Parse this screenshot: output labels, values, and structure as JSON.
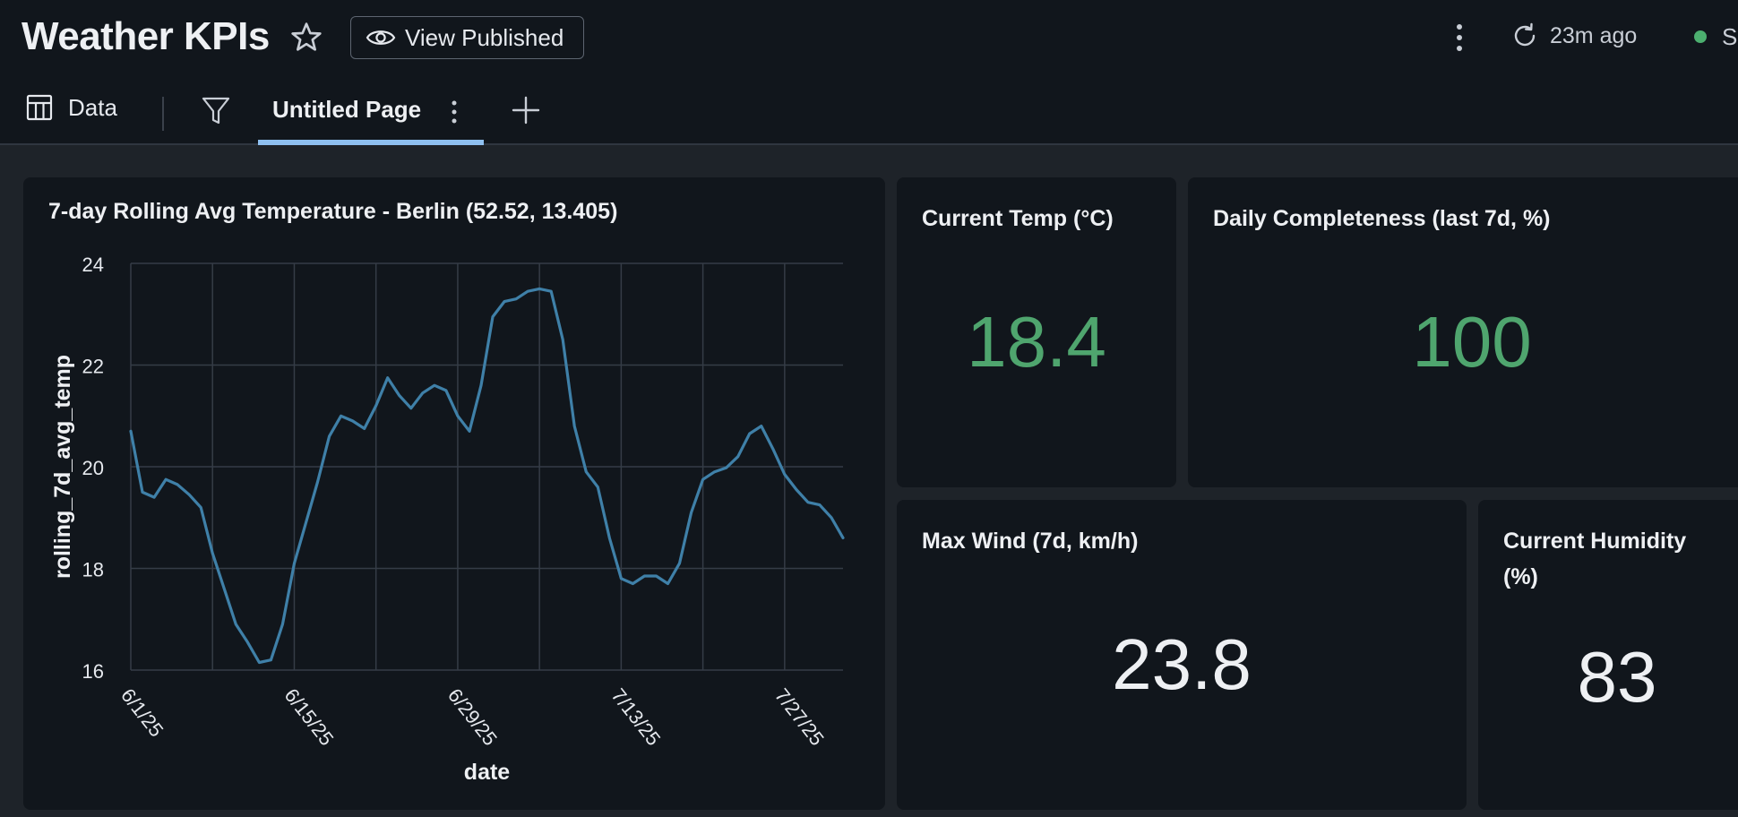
{
  "header": {
    "title": "Weather KPIs",
    "view_published_label": "View Published",
    "refresh_text": "23m ago",
    "status_text": "S"
  },
  "tabs": {
    "data_label": "Data",
    "active_page_label": "Untitled Page"
  },
  "colors": {
    "accent_tab": "#8fc0f0",
    "kpi_green": "#4fa56e",
    "kpi_white": "#eef0f3",
    "line_series": "#3f80a8"
  },
  "icons": {
    "star": "star-icon",
    "eye": "eye-icon",
    "kebab": "kebab-icon",
    "refresh": "refresh-icon",
    "table": "table-icon",
    "filter": "filter-icon",
    "plus": "plus-icon"
  },
  "kpis": {
    "current_temp": {
      "title": "Current Temp (°C)",
      "value": "18.4"
    },
    "daily_completeness": {
      "title": "Daily Completeness (last 7d, %)",
      "value": "100"
    },
    "max_wind": {
      "title": "Max Wind (7d, km/h)",
      "value": "23.8"
    },
    "current_humidity": {
      "title": "Current Humidity (%)",
      "value": "83"
    }
  },
  "chart_data": {
    "type": "line",
    "title": "7-day Rolling Avg Temperature - Berlin (52.52, 13.405)",
    "xlabel": "date",
    "ylabel": "rolling_7d_avg_temp",
    "ylim": [
      16,
      24
    ],
    "yticks": [
      "16",
      "18",
      "20",
      "22",
      "24"
    ],
    "xticks": [
      "6/1/25",
      "6/15/25",
      "6/29/25",
      "7/13/25",
      "7/27/25"
    ],
    "xlim": [
      "6/1/25",
      "8/1/25"
    ],
    "grid": true,
    "x": [
      "6/1/25",
      "6/2/25",
      "6/3/25",
      "6/4/25",
      "6/5/25",
      "6/6/25",
      "6/7/25",
      "6/8/25",
      "6/9/25",
      "6/10/25",
      "6/11/25",
      "6/12/25",
      "6/13/25",
      "6/14/25",
      "6/15/25",
      "6/16/25",
      "6/17/25",
      "6/18/25",
      "6/19/25",
      "6/20/25",
      "6/21/25",
      "6/22/25",
      "6/23/25",
      "6/24/25",
      "6/25/25",
      "6/26/25",
      "6/27/25",
      "6/28/25",
      "6/29/25",
      "6/30/25",
      "7/1/25",
      "7/2/25",
      "7/3/25",
      "7/4/25",
      "7/5/25",
      "7/6/25",
      "7/7/25",
      "7/8/25",
      "7/9/25",
      "7/10/25",
      "7/11/25",
      "7/12/25",
      "7/13/25",
      "7/14/25",
      "7/15/25",
      "7/16/25",
      "7/17/25",
      "7/18/25",
      "7/19/25",
      "7/20/25",
      "7/21/25",
      "7/22/25",
      "7/23/25",
      "7/24/25",
      "7/25/25",
      "7/26/25",
      "7/27/25",
      "7/28/25",
      "7/29/25",
      "7/30/25",
      "7/31/25",
      "8/1/25"
    ],
    "series": [
      {
        "values": [
          20.7,
          19.5,
          19.4,
          19.75,
          19.65,
          19.45,
          19.2,
          18.3,
          17.6,
          16.9,
          16.55,
          16.15,
          16.2,
          16.9,
          18.1,
          18.9,
          19.7,
          20.6,
          21.0,
          20.9,
          20.75,
          21.2,
          21.75,
          21.4,
          21.15,
          21.45,
          21.6,
          21.5,
          21.0,
          20.7,
          21.6,
          22.95,
          23.25,
          23.3,
          23.45,
          23.5,
          23.45,
          22.5,
          20.8,
          19.9,
          19.6,
          18.6,
          17.8,
          17.7,
          17.85,
          17.85,
          17.7,
          18.1,
          19.1,
          19.75,
          19.9,
          19.98,
          20.2,
          20.65,
          20.8,
          20.35,
          19.85,
          19.55,
          19.3,
          19.25,
          19.0,
          18.6
        ]
      }
    ]
  }
}
